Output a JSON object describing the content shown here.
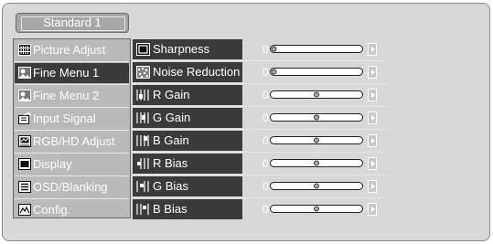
{
  "mode": {
    "label": "Standard 1"
  },
  "menu": {
    "items": [
      {
        "label": "Picture Adjust",
        "icon": "picture-adjust-icon",
        "selected": false
      },
      {
        "label": "Fine Menu 1",
        "icon": "fine-menu-icon",
        "selected": true
      },
      {
        "label": "Fine Menu 2",
        "icon": "fine-menu-icon",
        "selected": false
      },
      {
        "label": "Input Signal",
        "icon": "input-signal-icon",
        "selected": false
      },
      {
        "label": "RGB/HD Adjust",
        "icon": "rgb-hd-adjust-icon",
        "selected": false
      },
      {
        "label": "Display",
        "icon": "display-icon",
        "selected": false
      },
      {
        "label": "OSD/Blanking",
        "icon": "osd-blanking-icon",
        "selected": false
      },
      {
        "label": "Config.",
        "icon": "config-icon",
        "selected": false
      }
    ]
  },
  "params": [
    {
      "label": "Sharpness",
      "value": "0",
      "icon": "sharpness-icon",
      "level": 0.0
    },
    {
      "label": "Noise Reduction",
      "value": "0",
      "icon": "noise-reduction-icon",
      "level": 0.0
    },
    {
      "label": "R Gain",
      "value": "0",
      "icon": "gain-icon",
      "level": 0.5
    },
    {
      "label": "G Gain",
      "value": "0",
      "icon": "gain-icon",
      "level": 0.5
    },
    {
      "label": "B Gain",
      "value": "0",
      "icon": "gain-icon",
      "level": 0.5
    },
    {
      "label": "R Bias",
      "value": "0",
      "icon": "bias-icon",
      "level": 0.5
    },
    {
      "label": "G Bias",
      "value": "0",
      "icon": "bias-icon",
      "level": 0.5
    },
    {
      "label": "B Bias",
      "value": "0",
      "icon": "bias-icon",
      "level": 0.5
    }
  ],
  "colors": {
    "panel_bg": "#d8d8d8",
    "menu_bg": "#b9b9b9",
    "selected_bg": "#3b3b3b",
    "text": "#ffffff"
  }
}
